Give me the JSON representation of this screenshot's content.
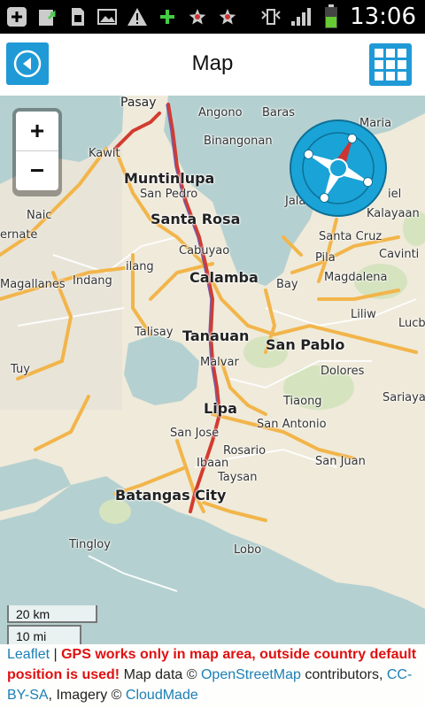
{
  "statusbar": {
    "time": "13:06",
    "icons": [
      "add-icon",
      "upload-icon",
      "sd-card-icon",
      "image-icon",
      "warning-icon",
      "plus-icon",
      "star-icon",
      "star-icon",
      "vibrate-icon",
      "signal-icon",
      "battery-icon"
    ]
  },
  "appbar": {
    "title": "Map",
    "back_icon": "back-arrow-icon",
    "menu_icon": "grid-icon"
  },
  "map": {
    "zoom_in": "+",
    "zoom_out": "−",
    "places": [
      {
        "id": "pasay",
        "label": "Pasay"
      },
      {
        "id": "angono",
        "label": "Angono"
      },
      {
        "id": "baras",
        "label": "Baras"
      },
      {
        "id": "maria",
        "label": "Maria"
      },
      {
        "id": "binangonan",
        "label": "Binangonan"
      },
      {
        "id": "kawit",
        "label": "Kawit"
      },
      {
        "id": "muntinlupa",
        "label": "Muntinlupa"
      },
      {
        "id": "sanpedro",
        "label": "San Pedro"
      },
      {
        "id": "santarosa",
        "label": "Santa Rosa"
      },
      {
        "id": "naic",
        "label": "Naic"
      },
      {
        "id": "ernate",
        "label": "ernate"
      },
      {
        "id": "cabuyao",
        "label": "Cabuyao"
      },
      {
        "id": "ilang",
        "label": "ilang"
      },
      {
        "id": "calamba",
        "label": "Calamba"
      },
      {
        "id": "magallanes",
        "label": "Magallanes"
      },
      {
        "id": "indang",
        "label": "Indang"
      },
      {
        "id": "bay",
        "label": "Bay"
      },
      {
        "id": "santacruz",
        "label": "Santa Cruz"
      },
      {
        "id": "pila",
        "label": "Pila"
      },
      {
        "id": "cavinti",
        "label": "Cavinti"
      },
      {
        "id": "magdalena",
        "label": "Magdalena"
      },
      {
        "id": "kalayaan",
        "label": "Kalayaan"
      },
      {
        "id": "jala",
        "label": "Jala"
      },
      {
        "id": "siniloan",
        "label": "iel"
      },
      {
        "id": "liliw",
        "label": "Liliw"
      },
      {
        "id": "lucb",
        "label": "Lucb"
      },
      {
        "id": "talisay",
        "label": "Talisay"
      },
      {
        "id": "tanauan",
        "label": "Tanauan"
      },
      {
        "id": "sanpablo",
        "label": "San Pablo"
      },
      {
        "id": "malvar",
        "label": "Malvar"
      },
      {
        "id": "dolores",
        "label": "Dolores"
      },
      {
        "id": "tuy",
        "label": "Tuy"
      },
      {
        "id": "tiaong",
        "label": "Tiaong"
      },
      {
        "id": "sariaya",
        "label": "Sariaya"
      },
      {
        "id": "lipa",
        "label": "Lipa"
      },
      {
        "id": "sanjose",
        "label": "San Jose"
      },
      {
        "id": "sanantonio",
        "label": "San Antonio"
      },
      {
        "id": "rosario",
        "label": "Rosario"
      },
      {
        "id": "sanjuan",
        "label": "San Juan"
      },
      {
        "id": "ibaan",
        "label": "Ibaan"
      },
      {
        "id": "taysan",
        "label": "Taysan"
      },
      {
        "id": "batangas",
        "label": "Batangas City"
      },
      {
        "id": "tingloy",
        "label": "Tingloy"
      },
      {
        "id": "lobo",
        "label": "Lobo"
      }
    ],
    "scale_km": "20 km",
    "scale_mi": "10 mi",
    "compass_directions": [
      "N",
      "E",
      "S",
      "W"
    ]
  },
  "attribution": {
    "leaflet": "Leaflet",
    "separator": " | ",
    "warning": "GPS works only in map area, outside country default position is used!",
    "map_data": " Map data © ",
    "osm": "OpenStreetMap",
    "contributors": " contributors, ",
    "license": "CC-BY-SA",
    "imagery": ", Imagery © ",
    "cloudmade": "CloudMade"
  },
  "colors": {
    "accent": "#1f9ad6",
    "water": "#b5d0d0",
    "land": "#efeada",
    "road_major": "#f2b54a",
    "road_red": "#d33b2f",
    "forest": "#d6e3bf",
    "warning": "#e01010",
    "link": "#1b7fb4"
  }
}
